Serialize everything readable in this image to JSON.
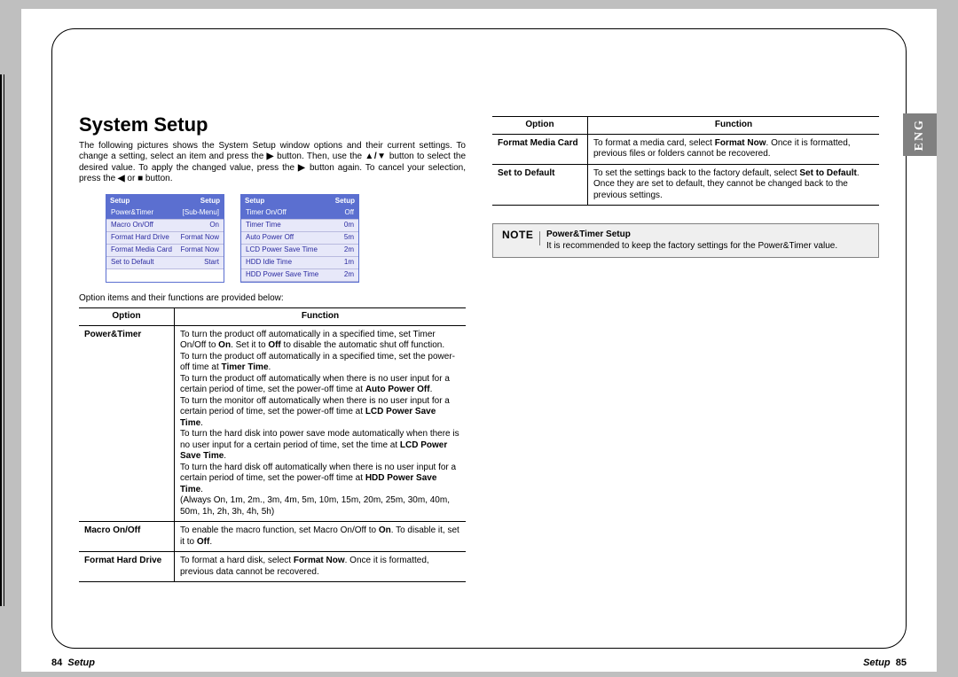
{
  "lang_tab": "ENG",
  "heading": "System Setup",
  "intro_fragments": {
    "a": "The following pictures shows the System Setup window options and their current settings. To change a setting, select an item and press the ",
    "b": " button. Then, use the ",
    "c": " button to select the desired value. To apply the changed value, press the ",
    "d": " button again. To cancel your selection, press the ",
    "e": " or ",
    "f": " button."
  },
  "arrows": {
    "right": "▶",
    "updown": "▲/▼",
    "left": "◀",
    "stop": "■"
  },
  "shot1": {
    "header_left": "Setup",
    "header_right": "Setup",
    "rows": [
      {
        "l": "Power&Timer",
        "r": "[Sub-Menu]",
        "sel": true
      },
      {
        "l": "Macro On/Off",
        "r": "On"
      },
      {
        "l": "Format Hard Drive",
        "r": "Format Now"
      },
      {
        "l": "Format Media Card",
        "r": "Format Now"
      },
      {
        "l": "Set to Default",
        "r": "Start"
      }
    ]
  },
  "shot2": {
    "header_left": "Setup",
    "header_right": "Setup",
    "rows": [
      {
        "l": "Timer On/Off",
        "r": "Off",
        "sel": true
      },
      {
        "l": "Timer Time",
        "r": "0m"
      },
      {
        "l": "Auto Power Off",
        "r": "5m"
      },
      {
        "l": "LCD Power Save Time",
        "r": "2m"
      },
      {
        "l": "HDD Idle Time",
        "r": "1m"
      },
      {
        "l": "HDD Power Save Time",
        "r": "2m"
      }
    ]
  },
  "below_text": "Option items and their functions are provided below:",
  "table1": {
    "head_option": "Option",
    "head_function": "Function",
    "rows": [
      {
        "option": "Power&Timer",
        "html": "To turn the product off automatically in a specified time, set Timer On/Off to <b>On</b>. Set it to <b>Off</b> to disable the automatic shut off function.<br>To turn the product off automatically in a specified time, set the power-off time at <b>Timer Time</b>.<br>To turn the product off automatically when there is no user input for a certain period of time, set the power-off time at <b>Auto Power Off</b>.<br>To turn the monitor off automatically when there is no user input for a certain period of time, set the power-off time at <b>LCD Power Save Time</b>.<br>To turn the hard disk into power save mode automatically when there is no user input for a certain period of time, set the time at <b>LCD Power Save Time</b>.<br>To turn the hard disk off automatically when there is no user input for a certain period of time, set the power-off time at <b>HDD Power Save Time</b>.<br>(Always On, 1m, 2m., 3m, 4m, 5m, 10m, 15m, 20m, 25m, 30m, 40m, 50m, 1h, 2h, 3h, 4h, 5h)"
      },
      {
        "option": "Macro On/Off",
        "html": "To enable the macro function, set Macro On/Off to <b>On</b>. To disable it, set it to <b>Off</b>."
      },
      {
        "option": "Format Hard Drive",
        "html": "To format a hard disk, select <b>Format Now</b>. Once it is formatted, previous data cannot be recovered."
      }
    ]
  },
  "table2": {
    "head_option": "Option",
    "head_function": "Function",
    "rows": [
      {
        "option": "Format Media Card",
        "html": "To format a media card, select <b>Format Now</b>. Once it is formatted, previous files or folders cannot be recovered."
      },
      {
        "option": "Set to Default",
        "html": "To set the settings back to the factory default, select <b>Set to Default</b>. Once they are set to default, they cannot be changed back to the previous settings."
      }
    ]
  },
  "note": {
    "label": "NOTE",
    "title": "Power&Timer Setup",
    "body": "It is recommended to keep the factory settings for the Power&Timer value."
  },
  "footer": {
    "left_num": "84",
    "left_text": "Setup",
    "right_text": "Setup",
    "right_num": "85"
  }
}
